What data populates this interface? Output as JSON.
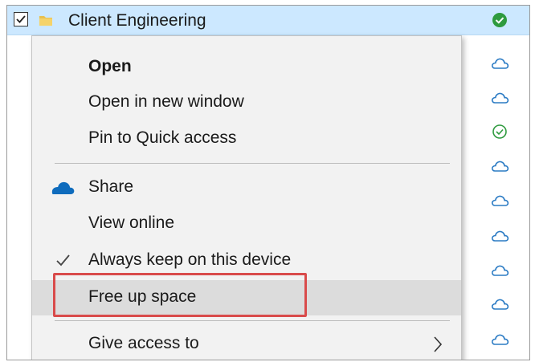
{
  "row": {
    "name": "Client Engineering",
    "checked": true,
    "folder_icon": "folder-icon"
  },
  "status_icons": [
    "available-pinned-icon",
    "cloud-online-only-icon",
    "cloud-online-only-icon",
    "available-locally-icon",
    "cloud-online-only-icon",
    "cloud-online-only-icon",
    "cloud-online-only-icon",
    "cloud-online-only-icon",
    "cloud-online-only-icon",
    "cloud-online-only-icon"
  ],
  "context_menu": {
    "open": "Open",
    "open_new_window": "Open in new window",
    "pin_quick_access": "Pin to Quick access",
    "share": "Share",
    "share_icon": "onedrive-cloud-icon",
    "view_online": "View online",
    "always_keep": "Always keep on this device",
    "always_keep_checked": true,
    "free_up_space": "Free up space",
    "give_access": "Give access to"
  },
  "colors": {
    "selection": "#cce8ff",
    "menu_background": "#f2f2f2",
    "menu_highlight": "#dcdcdc",
    "annotation": "#d94b4b",
    "pinned_green": "#2e9a3e",
    "cloud_blue": "#2b7bc4",
    "onedrive_blue": "#0f6cbd"
  }
}
